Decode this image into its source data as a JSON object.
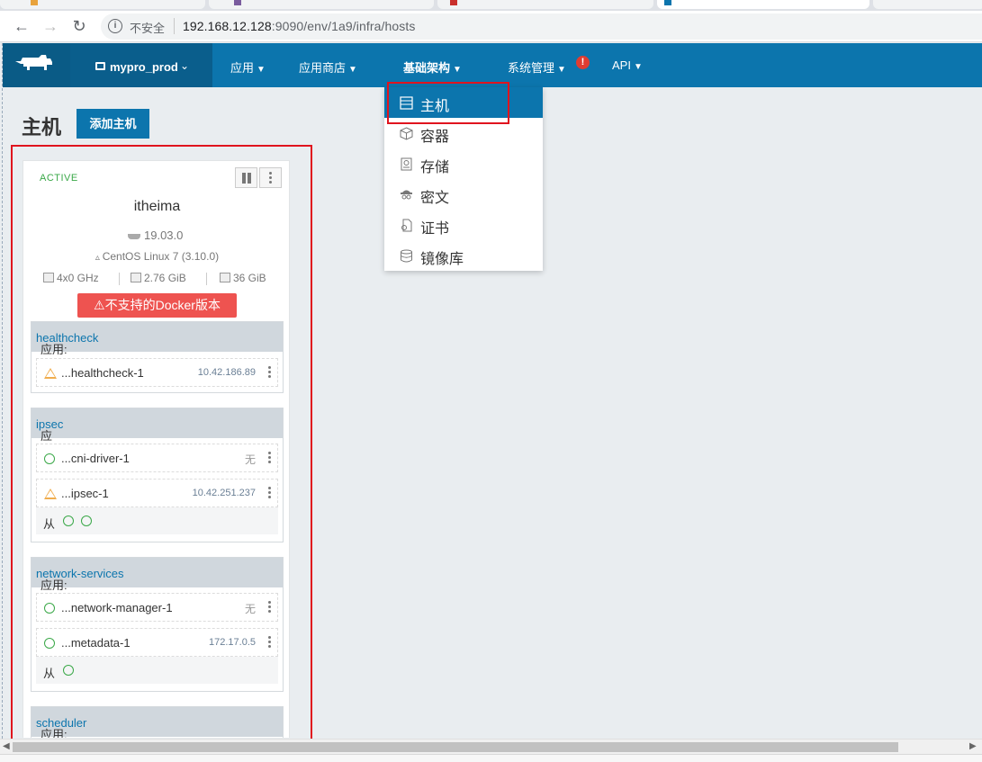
{
  "browser": {
    "insecure_label": "不安全",
    "url_host": "192.168.12.128",
    "url_rest": ":9090/env/1a9/infra/hosts"
  },
  "header": {
    "environment": "mypro_prod",
    "nav": [
      {
        "label": "应用"
      },
      {
        "label": "应用商店"
      },
      {
        "label": "基础架构"
      },
      {
        "label": "系统管理"
      },
      {
        "label": "API"
      }
    ],
    "alert_badge": "!"
  },
  "infra_menu": {
    "items": [
      {
        "label": "主机",
        "icon": "host-icon",
        "selected": true
      },
      {
        "label": "容器",
        "icon": "container-icon"
      },
      {
        "label": "存储",
        "icon": "storage-icon"
      },
      {
        "label": "密文",
        "icon": "secret-icon"
      },
      {
        "label": "证书",
        "icon": "certificate-icon"
      },
      {
        "label": "镜像库",
        "icon": "registry-icon"
      }
    ]
  },
  "page": {
    "title": "主机",
    "add_host_button": "添加主机"
  },
  "host": {
    "state": "ACTIVE",
    "name": "itheima",
    "docker_version": "19.03.0",
    "os": "CentOS Linux 7 (3.10.0)",
    "cpu": "4x0 GHz",
    "memory": "2.76 GiB",
    "disk": "36 GiB",
    "warning": "不支持的Docker版本"
  },
  "stacks": [
    {
      "prefix": "应用: ",
      "name": "healthcheck",
      "containers": [
        {
          "status": "warning",
          "name": "...healthcheck-1",
          "ip": "10.42.186.89"
        }
      ]
    },
    {
      "prefix": "应用: ",
      "name": "ipsec",
      "containers": [
        {
          "status": "ok",
          "name": "...cni-driver-1",
          "ip": "无"
        },
        {
          "status": "warning",
          "name": "...ipsec-1",
          "ip": "10.42.251.237"
        }
      ],
      "sidekick_label": "从"
    },
    {
      "prefix": "应用: ",
      "name": "network-services",
      "containers": [
        {
          "status": "ok",
          "name": "...network-manager-1",
          "ip": "无"
        },
        {
          "status": "ok",
          "name": "...metadata-1",
          "ip": "172.17.0.5"
        }
      ],
      "sidekick_label": "从"
    },
    {
      "prefix": "应用: ",
      "name": "scheduler"
    }
  ],
  "colors": {
    "header_blue": "#0c75ad",
    "active_green": "#3aa848",
    "warning_red": "#ee5350",
    "highlight_red": "#e0141e"
  }
}
